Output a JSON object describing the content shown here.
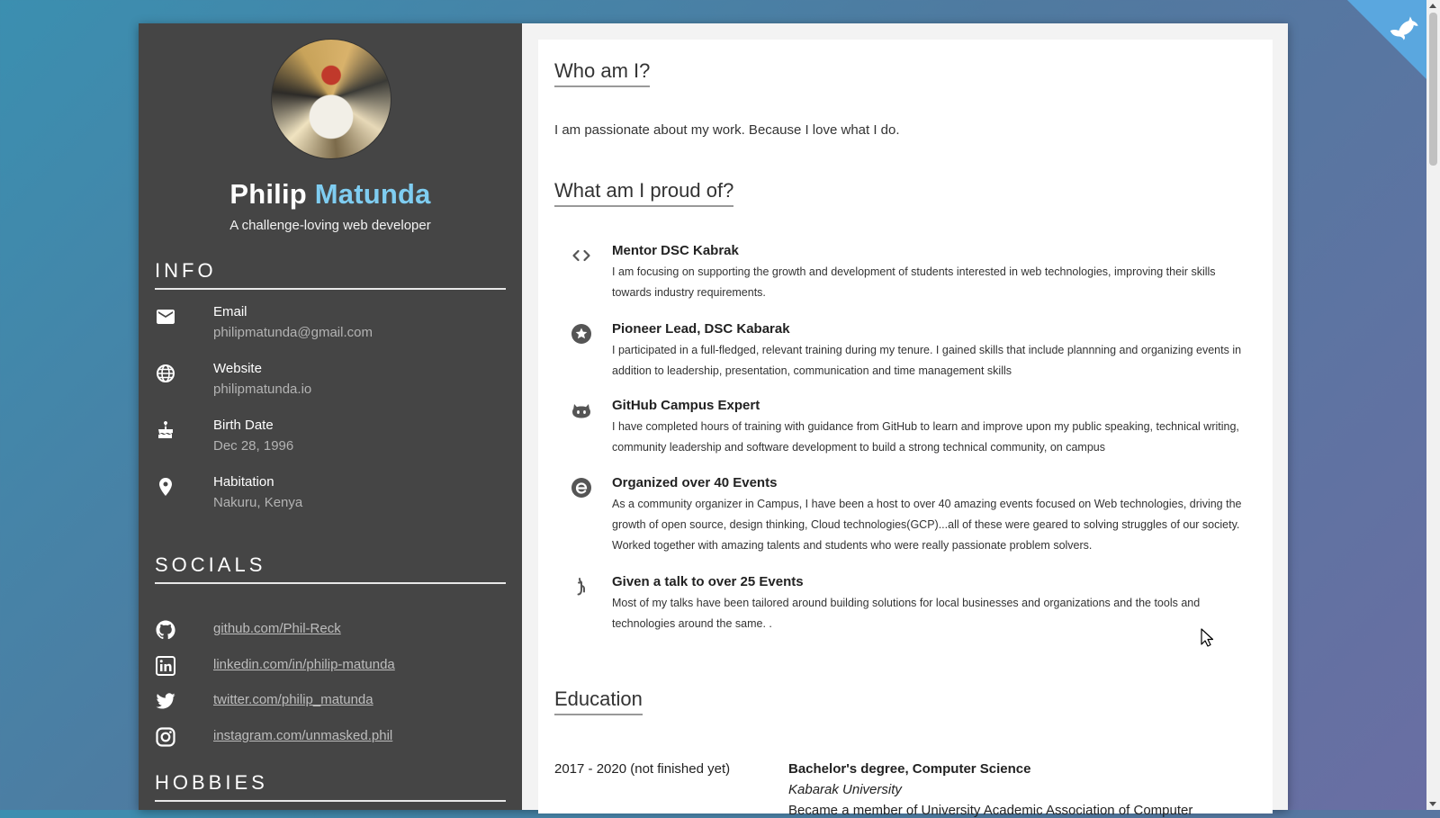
{
  "profile": {
    "first_name": "Philip",
    "last_name": "Matunda",
    "tagline": "A challenge-loving web developer"
  },
  "info": {
    "title": "INFO",
    "items": [
      {
        "label": "Email",
        "value": "philipmatunda@gmail.com",
        "icon": "email-icon"
      },
      {
        "label": "Website",
        "value": "philipmatunda.io",
        "icon": "globe-icon"
      },
      {
        "label": "Birth Date",
        "value": "Dec 28, 1996",
        "icon": "cake-icon"
      },
      {
        "label": "Habitation",
        "value": "Nakuru, Kenya",
        "icon": "location-pin-icon"
      }
    ]
  },
  "socials": {
    "title": "SOCIALS",
    "items": [
      {
        "text": "github.com/Phil-Reck",
        "icon": "github-icon"
      },
      {
        "text": "linkedin.com/in/philip-matunda",
        "icon": "linkedin-icon"
      },
      {
        "text": "twitter.com/philip_matunda",
        "icon": "twitter-icon"
      },
      {
        "text": "instagram.com/unmasked.phil",
        "icon": "instagram-icon"
      }
    ]
  },
  "hobbies": {
    "title": "HOBBIES"
  },
  "about": {
    "title": "Who am I?",
    "text": "I am passionate about my work. Because I love what I do."
  },
  "proud": {
    "title": "What am I proud of?",
    "items": [
      {
        "title": "Mentor DSC Kabrak",
        "desc": "I am focusing on supporting the growth and development of students interested in web technologies, improving their skills towards industry requirements.",
        "icon": "code-icon"
      },
      {
        "title": "Pioneer Lead, DSC Kabarak",
        "desc": "I participated in a full-fledged, relevant training during my tenure. I gained skills that include plannning and organizing events in addition to leadership, presentation, communication and time management skills",
        "icon": "star-icon"
      },
      {
        "title": "GitHub Campus Expert",
        "desc": "I have completed hours of training with guidance from GitHub to learn and improve upon my public speaking, technical writing, community leadership and software development to build a strong technical community, on campus",
        "icon": "github-cat-icon"
      },
      {
        "title": "Organized over 40 Events",
        "desc": "As a community organizer in Campus, I have been a host to over 40 amazing events focused on Web technologies, driving the growth of open source, design thinking, Cloud technologies(GCP)...all of these were geared to solving struggles of our society. Worked together with amazing talents and students who were really passionate problem solvers.",
        "icon": "edge-e-icon"
      },
      {
        "title": "Given a talk to over 25 Events",
        "desc": "Most of my talks have been tailored around building solutions for local businesses and organizations and the tools and technologies around the same. .",
        "icon": "microphone-icon"
      }
    ]
  },
  "education": {
    "title": "Education",
    "entries": [
      {
        "years": "2017 - 2020 (not finished yet)",
        "degree": "Bachelor's degree, Computer Science",
        "school": "Kabarak University",
        "desc": "Became a member of University Academic Association of Computer"
      }
    ]
  },
  "colors": {
    "accent": "#7fcdf1",
    "sidebar_bg": "#454545",
    "corner_ribbon": "#5aa7df"
  }
}
